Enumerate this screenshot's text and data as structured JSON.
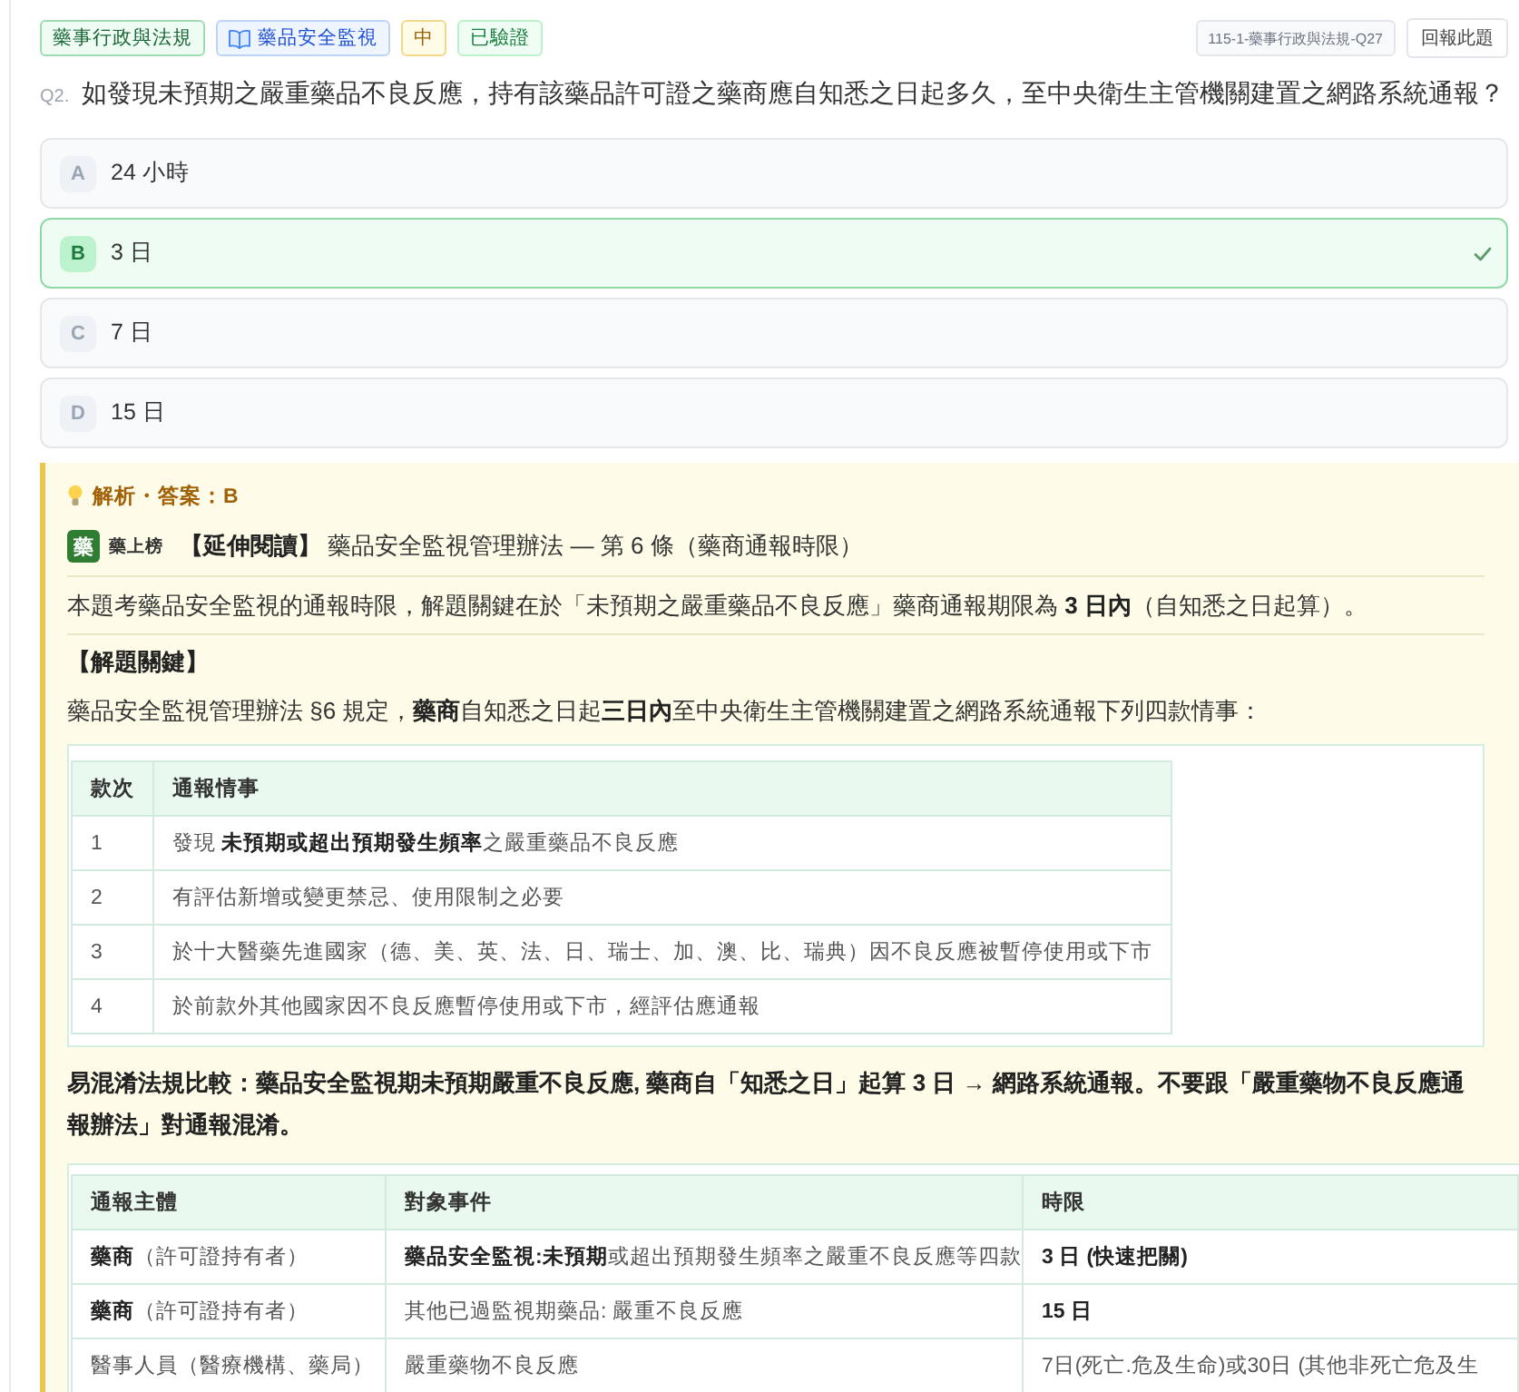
{
  "tags": [
    {
      "kind": "subject",
      "label": "藥事行政與法規"
    },
    {
      "kind": "topic",
      "label": "藥品安全監視"
    },
    {
      "kind": "difficulty",
      "label": "中"
    },
    {
      "kind": "verified",
      "label": "已驗證"
    }
  ],
  "source_tag": "115-1-藥事行政與法規-Q27",
  "report_button": "回報此題",
  "question": {
    "number": "Q2.",
    "text": "如發現未預期之嚴重藥品不良反應，持有該藥品許可證之藥商應自知悉之日起多久，至中央衛生主管機關建置之網路系統通報？"
  },
  "options": [
    {
      "letter": "A",
      "text": "24 小時",
      "selected": false
    },
    {
      "letter": "B",
      "text": "3 日",
      "selected": true
    },
    {
      "letter": "C",
      "text": "7 日",
      "selected": false
    },
    {
      "letter": "D",
      "text": "15 日",
      "selected": false
    }
  ],
  "explanation": {
    "heading": "解析・答案：B",
    "source": {
      "logo": "藥",
      "name": "藥上榜",
      "title": "**【延伸閱讀】** 藥品安全監視管理辦法 — 第 6 條（藥商通報時限）"
    },
    "summary": "本題考藥品安全監視的通報時限，解題關鍵在於「未預期之嚴重藥品不良反應」藥商通報期限為 **3 日內**（自知悉之日起算）。",
    "key_heading": "【解題關鍵】",
    "key_text": "藥品安全監視管理辦法 §6 規定，**藥商**自知悉之日起**三日內**至中央衛生主管機關建置之網路系統通報下列四款情事：",
    "table_1": {
      "columns": [
        "款次",
        "通報情事"
      ],
      "rows": [
        [
          "1",
          "發現 **未預期或超出預期發生頻率**之嚴重藥品不良反應"
        ],
        [
          "2",
          "有評估新增或變更禁忌、使用限制之必要"
        ],
        [
          "3",
          "於十大醫藥先進國家（德、美、英、法、日、瑞士、加、澳、比、瑞典）因不良反應被暫停使用或下市"
        ],
        [
          "4",
          "於前款外其他國家因不良反應暫停使用或下市，經評估應通報"
        ]
      ]
    },
    "comparison": "易混淆法規比較：藥品安全監視期未預期嚴重不良反應, 藥商自「知悉之日」起算 3 日 → 網路系統通報。不要跟「嚴重藥物不良反應通報辦法」對通報混淆。",
    "table_2": {
      "columns": [
        "通報主體",
        "對象事件",
        "時限"
      ],
      "rows": [
        {
          "reporter": "**藥商**（許可證持有者）",
          "event": "**藥品安全監視:未預期**或超出預期發生頻率之嚴重不良反應等四款",
          "deadline": "3 日 (快速把關)",
          "emphasized": true
        },
        {
          "reporter": "**藥商**（許可證持有者）",
          "event": "其他已過監視期藥品: 嚴重不良反應",
          "deadline": "15 日",
          "emphasized": true
        },
        {
          "reporter": "醫事人員（醫療機構、藥局）",
          "event": "嚴重藥物不良反應",
          "deadline": "7日(死亡.危及生命)或30日 (其他非死亡危及生",
          "emphasized": false
        }
      ]
    }
  }
}
